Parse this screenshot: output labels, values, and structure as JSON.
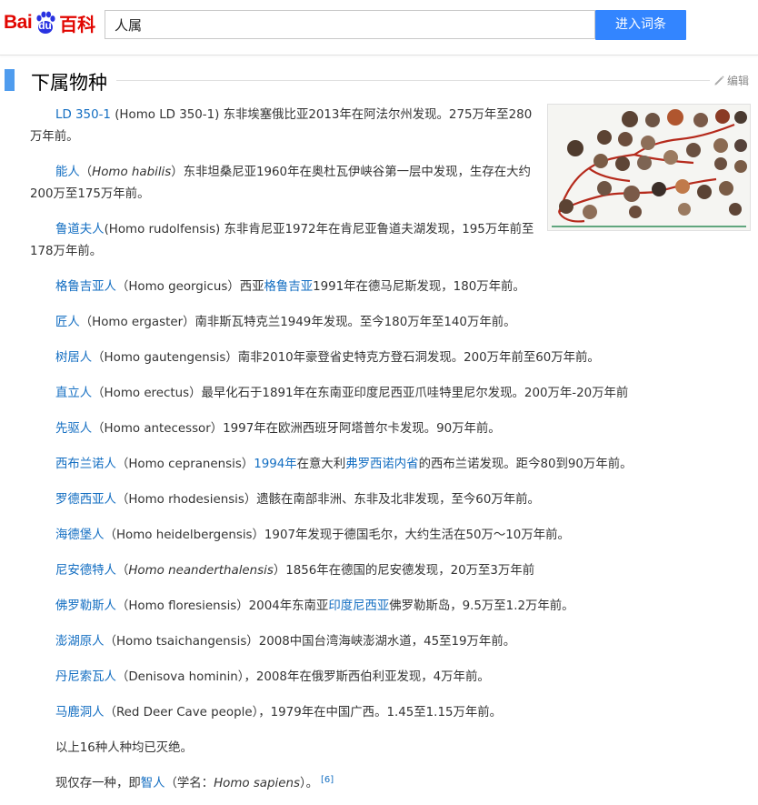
{
  "header": {
    "logo_bai": "Bai",
    "logo_du": "du",
    "logo_baike": "百科",
    "search_value": "人属",
    "search_button": "进入词条"
  },
  "section": {
    "title": "下属物种",
    "edit_label": "编辑"
  },
  "paragraphs": [
    {
      "link": "LD 350-1",
      "rest": " (Homo LD 350-1) 东非埃塞俄比亚2013年在阿法尔州发现。275万年至280万年前。"
    },
    {
      "link": "能人",
      "pre": "（",
      "latin": "Homo habilis",
      "rest": "）东非坦桑尼亚1960年在奥杜瓦伊峡谷第一层中发现，生存在大约200万至175万年前。"
    },
    {
      "link": "鲁道夫人",
      "rest": "(Homo rudolfensis) 东非肯尼亚1972年在肯尼亚鲁道夫湖发现，195万年前至178万年前。"
    },
    {
      "link": "格鲁吉亚人",
      "mid": "（Homo georgicus）西亚",
      "link2": "格鲁吉亚",
      "rest": "1991年在德马尼斯发现，180万年前。"
    },
    {
      "link": "匠人",
      "rest": "（Homo ergaster）南非斯瓦特克兰1949年发现。至今180万年至140万年前。"
    },
    {
      "link": "树居人",
      "rest": "（Homo gautengensis）南非2010年豪登省史特克方登石洞发现。200万年前至60万年前。"
    },
    {
      "link": "直立人",
      "rest": "（Homo erectus）最早化石于1891年在东南亚印度尼西亚爪哇特里尼尔发现。200万年-20万年前"
    },
    {
      "link": "先驱人",
      "rest": "（Homo antecessor）1997年在欧洲西班牙阿塔普尔卡发现。90万年前。"
    },
    {
      "link": "西布兰诺人",
      "mid": "（Homo cepranensis）",
      "link2": "1994年",
      "mid2": "在意大利",
      "link3": "弗罗西诺内省",
      "rest": "的西布兰诺发现。距今80到90万年前。"
    },
    {
      "link": "罗德西亚人",
      "rest": "（Homo rhodesiensis）遗骸在南部非洲、东非及北非发现，至今60万年前。"
    },
    {
      "link": "海德堡人",
      "rest": "（Homo heidelbergensis）1907年发现于德国毛尔，大约生活在50万～10万年前。"
    },
    {
      "link": "尼安德特人",
      "pre": "（",
      "latin": "Homo neanderthalensis",
      "rest": "）1856年在德国的尼安德发现，20万至3万年前"
    },
    {
      "link": "佛罗勒斯人",
      "mid": "（Homo floresiensis）2004年东南亚",
      "link2": "印度尼西亚",
      "rest": "佛罗勒斯岛，9.5万至1.2万年前。"
    },
    {
      "link": "澎湖原人",
      "rest": "（Homo tsaichangensis）2008中国台湾海峡澎湖水道，45至19万年前。"
    },
    {
      "link": "丹尼索瓦人",
      "rest": "（Denisova hominin），2008年在俄罗斯西伯利亚发现，4万年前。"
    },
    {
      "link": "马鹿洞人",
      "rest": "（Red Deer Cave people），1979年在中国广西。1.45至1.15万年前。"
    }
  ],
  "summary": "以上16种人种均已灭绝。",
  "last": {
    "pre": "现仅存一种，即",
    "link": "智人",
    "mid": "（学名：",
    "latin": "Homo sapiens",
    "post": "）。",
    "ref": "[6]"
  },
  "colors": {
    "link": "#136ec2",
    "accent": "#4f9cee",
    "button": "#3385ff",
    "logo": "#e10601"
  },
  "icons": {
    "edit": "pencil-icon",
    "logo": "baidu-paw-icon"
  }
}
